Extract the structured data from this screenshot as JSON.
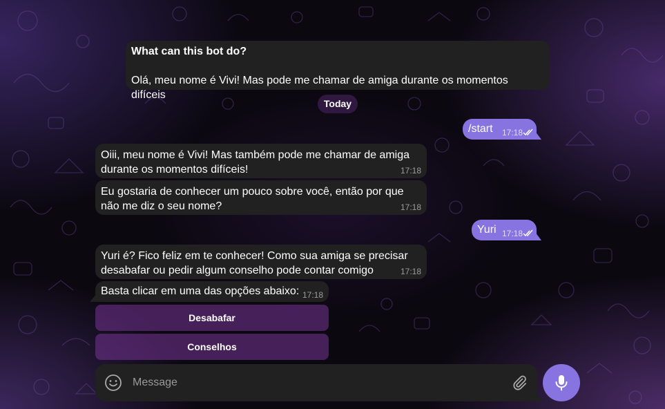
{
  "bot_info": {
    "title": "What can this bot do?",
    "text": "Olá, meu nome é Vivi! Mas pode me chamar de amiga durante os momentos difíceis"
  },
  "date_separator": "Today",
  "messages": [
    {
      "direction": "out",
      "text": "/start",
      "time": "17:18",
      "read": true
    },
    {
      "direction": "in",
      "text": "Oiii, meu nome é Vivi! Mas também pode me chamar de amiga durante os momentos difíceis!",
      "time": "17:18"
    },
    {
      "direction": "in",
      "text": "Eu gostaria de conhecer um pouco sobre você, então por que não me diz o seu nome?",
      "time": "17:18"
    },
    {
      "direction": "out",
      "text": "Yuri",
      "time": "17:18",
      "read": true
    },
    {
      "direction": "in",
      "text": "Yuri é? Fico feliz em te conhecer! Como sua amiga se precisar desabafar ou pedir algum conselho pode contar comigo",
      "time": "17:18"
    },
    {
      "direction": "in",
      "text": "Basta clicar em uma das opções abaixo:",
      "time": "17:18"
    }
  ],
  "keyboard": {
    "buttons": [
      "Desabafar",
      "Conselhos"
    ]
  },
  "composer": {
    "placeholder": "Message"
  },
  "icons": {
    "emoji": "smile-icon",
    "attach": "paperclip-icon",
    "mic": "microphone-icon",
    "read_receipt": "double-check-icon"
  },
  "colors": {
    "outgoing_bubble": "#8774e1",
    "incoming_bubble": "#212121",
    "keyboard_button": "#5a2a74",
    "accent": "#8774e1"
  }
}
